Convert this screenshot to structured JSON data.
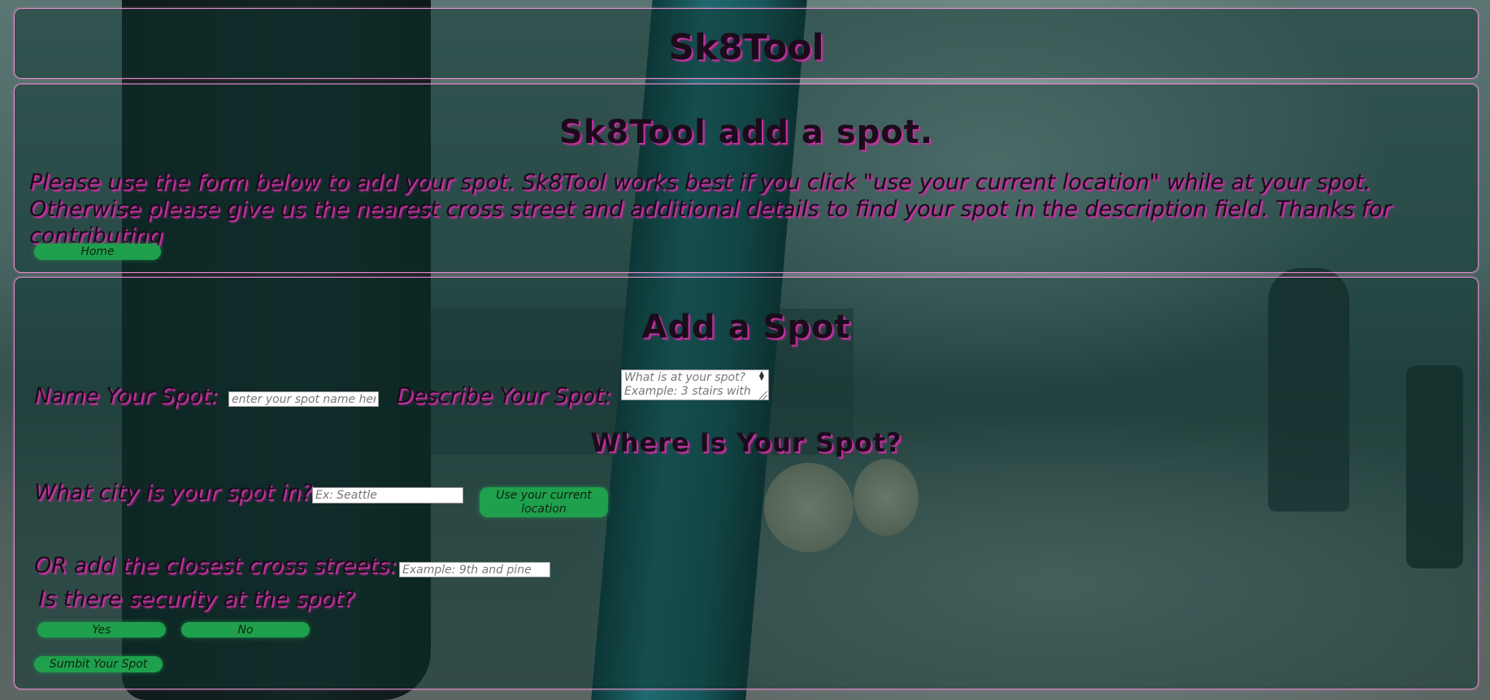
{
  "header": {
    "site_title": "Sk8Tool"
  },
  "intro": {
    "title": "Sk8Tool add a spot.",
    "text": "Please use the form below to add your spot. Sk8Tool works best if you click \"use your current location\" while at your spot. Otherwise please give us the nearest cross street and additional details to find your spot in the description field. Thanks for contributing",
    "home_label": "Home"
  },
  "form": {
    "title": "Add a Spot",
    "name_label": "Name Your Spot:",
    "name_placeholder": "enter your spot name here",
    "desc_label": "Describe Your Spot:",
    "desc_placeholder": "What is at your spot? Example: 3 stairs with",
    "where_title": "Where Is Your Spot?",
    "city_label": "What city is your spot in?",
    "city_placeholder": "Ex: Seattle",
    "location_label": "Use your current location",
    "cross_label": "OR add the closest cross streets:",
    "cross_placeholder": "Example: 9th and pine",
    "security_label": "Is there security at the spot?",
    "yes_label": "Yes",
    "no_label": "No",
    "submit_label": "Sumbit Your Spot"
  },
  "colors": {
    "panel_border": "#e08ac8",
    "button_green": "#1fa04c",
    "text_shadow": "#c4309e"
  }
}
